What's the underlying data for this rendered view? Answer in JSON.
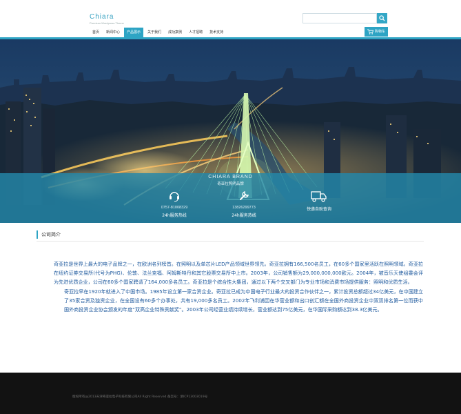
{
  "header": {
    "logo_name": "Chiara",
    "logo_tagline": "Premium Wordpress Theme",
    "search_placeholder": "",
    "cart_label": "购物车"
  },
  "nav": {
    "items": [
      {
        "label": "首页"
      },
      {
        "label": "新闻中心"
      },
      {
        "label": "产品展示",
        "active": true
      },
      {
        "label": "关于我们"
      },
      {
        "label": "成功案例"
      },
      {
        "label": "人才招聘"
      },
      {
        "label": "技术支持"
      }
    ]
  },
  "banner": {
    "brand_title": "CHIARA BRAND",
    "brand_subtitle": "奇亚拉照明品牌",
    "services": [
      {
        "icon": "headset-icon",
        "phone": "0757-81008329",
        "label": "24h服务热线"
      },
      {
        "icon": "wrench-icon",
        "phone": "13826299773",
        "label": "24h服务热线"
      },
      {
        "icon": "truck-icon",
        "phone": "",
        "label": "快递自助查询"
      }
    ]
  },
  "company": {
    "title": "公司简介",
    "paragraph1": "奇亚拉是世界上最大的电子品牌之一，在欧洲名列榜首。在照明以及单芯片LED产品领域世界领先。奇亚拉拥有166,500名员工，在60多个国家里活跃在照明领域。奇亚拉在纽约证券交易所(代号为PHG)、伦敦、法兰克福、阿姆斯特丹和其它股票交易所中上市。2003年，公司销售额为29,000,000,000欧元。2004年，被音乐天使组委会评为先进优质企业，公司在60多个国家聘请了164,000多名员工。奇亚拉是个综合性大集团，通过以下两个交叉部门为专业市场和消费市场提供服务：照明和优质生活。",
    "paragraph2": "奇亚拉早在1920年就进入了中国市场。1985年设立第一家合资企业。奇亚拉已成为中国电子行业最大的投资合作伙伴之一，累计投资总额超过34亿美元，在中国建立了35家合资及独资企业，在全国设有60多个办事处，共有19,000多名员工。2002年飞利浦因在华营业额和出口创汇额在全国外商投资企业中双双排名第一位而获中国外商投资企业协会颁发的年度“双高企业特殊贡献奖”。2003年公司经营业绩持续增长，营业额达到75亿美元，在华国际采购额达到38.3亿美元。"
  },
  "footer": {
    "copyright": "版权所有@2013天津奇亚拉电子科技有限公司All Right Reserved 备案号：浙ICP13003019号"
  },
  "colors": {
    "accent": "#2ea4c4",
    "intro_text": "#1f5a9e",
    "footer_bg": "#121212"
  }
}
